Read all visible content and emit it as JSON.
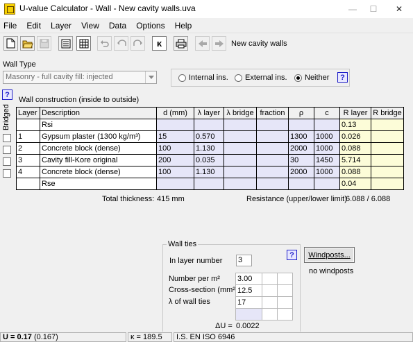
{
  "window": {
    "title": "U-value Calculator - Wall - New cavity walls.uva",
    "minimize": "—",
    "maximize": "☐",
    "close": "✕"
  },
  "menu": [
    "File",
    "Edit",
    "Layer",
    "View",
    "Data",
    "Options",
    "Help"
  ],
  "toolbar": {
    "project_name": "New cavity walls",
    "buttons": [
      {
        "name": "new-document-icon"
      },
      {
        "name": "open-folder-icon"
      },
      {
        "name": "save-disk-icon"
      },
      {
        "name": "report-icon"
      },
      {
        "name": "calculator-icon"
      },
      {
        "name": "undo-icon"
      },
      {
        "name": "undo2-icon"
      },
      {
        "name": "redo-icon"
      },
      {
        "name": "kappa-icon",
        "label": "κ"
      },
      {
        "name": "printer-icon"
      },
      {
        "name": "arrow-left-icon"
      },
      {
        "name": "arrow-right-icon"
      }
    ]
  },
  "wall_type": {
    "label": "Wall Type",
    "selected": "Masonry - full cavity fill: injected"
  },
  "insulation": {
    "options": [
      "Internal ins.",
      "External ins.",
      "Neither"
    ],
    "selected": 2,
    "help": "?"
  },
  "construction": {
    "help": "?",
    "title": "Wall construction (inside to outside)",
    "bridged_label": "Bridged",
    "headers": [
      "Layer",
      "Description",
      "d (mm)",
      "λ layer",
      "λ bridge",
      "fraction",
      "ρ",
      "c",
      "R layer",
      "R bridge"
    ],
    "rows": [
      {
        "layer": "",
        "desc": "Rsi",
        "d": "",
        "lambda": "",
        "lbridge": "",
        "fraction": "",
        "rho": "",
        "c": "",
        "r": "0.13",
        "rb": "",
        "type": "surface"
      },
      {
        "layer": "1",
        "desc": "Gypsum plaster (1300 kg/m³)",
        "d": "15",
        "lambda": "0.570",
        "lbridge": "",
        "fraction": "",
        "rho": "1300",
        "c": "1000",
        "r": "0.026",
        "rb": "",
        "type": "layer"
      },
      {
        "layer": "2",
        "desc": "Concrete block (dense)",
        "d": "100",
        "lambda": "1.130",
        "lbridge": "",
        "fraction": "",
        "rho": "2000",
        "c": "1000",
        "r": "0.088",
        "rb": "",
        "type": "layer"
      },
      {
        "layer": "3",
        "desc": "Cavity fill-Kore original",
        "d": "200",
        "lambda": "0.035",
        "lbridge": "",
        "fraction": "",
        "rho": "30",
        "c": "1450",
        "r": "5.714",
        "rb": "",
        "type": "layer"
      },
      {
        "layer": "4",
        "desc": "Concrete block (dense)",
        "d": "100",
        "lambda": "1.130",
        "lbridge": "",
        "fraction": "",
        "rho": "2000",
        "c": "1000",
        "r": "0.088",
        "rb": "",
        "type": "layer"
      },
      {
        "layer": "",
        "desc": "Rse",
        "d": "",
        "lambda": "",
        "lbridge": "",
        "fraction": "",
        "rho": "",
        "c": "",
        "r": "0.04",
        "rb": "",
        "type": "surface"
      }
    ],
    "total_thickness_label": "Total thickness:",
    "total_thickness_value": "415 mm",
    "resistance_label": "Resistance (upper/lower limit)",
    "resistance_value": "6.088 / 6.088"
  },
  "wall_ties": {
    "title": "Wall ties",
    "help": "?",
    "in_layer_label": "In layer number",
    "in_layer_value": "3",
    "rows": [
      {
        "label": "Number per m²",
        "value": "3.00"
      },
      {
        "label": "Cross-section (mm²)",
        "value": "12.5"
      },
      {
        "label": "λ  of wall ties",
        "value": "17"
      }
    ],
    "delta_u_label": "ΔU =",
    "delta_u_value": "0.0022"
  },
  "windposts": {
    "button": "Windposts...",
    "status": "no windposts"
  },
  "status": {
    "u_label": "U = 0.17",
    "u_sub": "(0.167)",
    "kappa": "κ = 189.5",
    "standard": "I.S. EN ISO 6946"
  }
}
